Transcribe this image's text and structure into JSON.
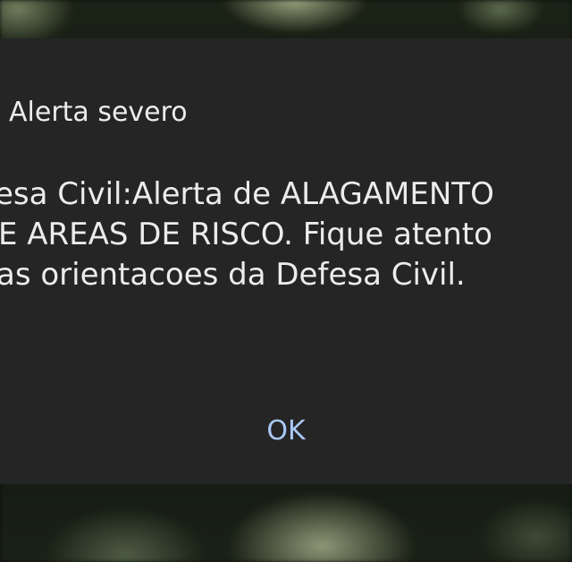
{
  "dialog": {
    "title": "Alerta severo",
    "message_lines": [
      "esa Civil:Alerta de ALAGAMENTO",
      "E AREAS DE RISCO. Fique atento",
      "as orientacoes da Defesa Civil."
    ],
    "ok_label": "OK"
  },
  "colors": {
    "dialog_background": "#252525",
    "text": "#ececec",
    "button_accent": "#a9c8f5"
  }
}
